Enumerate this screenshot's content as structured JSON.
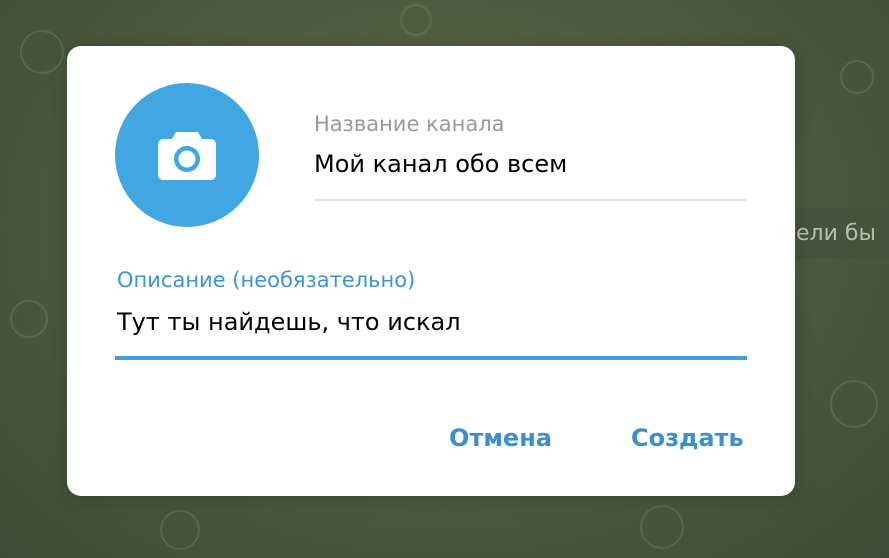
{
  "background": {
    "chat_fragment_text": "ели бы"
  },
  "dialog": {
    "avatar_icon": "camera-icon",
    "channel_name_label": "Название канала",
    "channel_name_value": "Мой канал обо всем",
    "description_label": "Описание (необязательно)",
    "description_value": "Тут ты найдешь, что искал",
    "cancel_label": "Отмена",
    "create_label": "Создать"
  },
  "colors": {
    "accent": "#40a7e3",
    "link_button": "#3a8fcc",
    "active_field": "#3a9fdc",
    "inactive_label": "#999999"
  }
}
